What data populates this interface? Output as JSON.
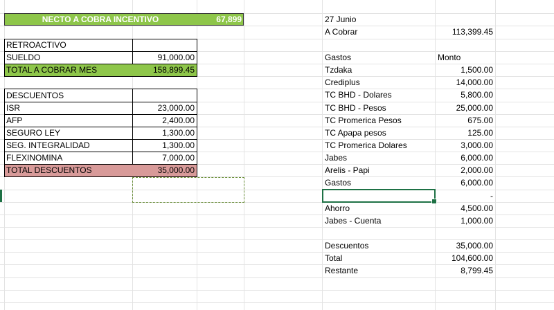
{
  "left": {
    "header": {
      "label": "NECTO  A COBRA INCENTIVO",
      "value": "67,899"
    },
    "retro": {
      "label": "RETROACTIVO",
      "value": ""
    },
    "sueldo": {
      "label": "SUELDO",
      "value": "91,000.00"
    },
    "total_mes": {
      "label": "TOTAL A COBRAR MES",
      "value": "158,899.45"
    },
    "descuentos_title": "DESCUENTOS",
    "descuentos": [
      {
        "label": "ISR",
        "value": "23,000.00"
      },
      {
        "label": "AFP",
        "value": "2,400.00"
      },
      {
        "label": "SEGURO LEY",
        "value": "1,300.00"
      },
      {
        "label": "SEG. INTEGRALIDAD",
        "value": "1,300.00"
      },
      {
        "label": "FLEXINOMINA",
        "value": "7,000.00"
      }
    ],
    "total_descuentos": {
      "label": "TOTAL DESCUENTOS",
      "value": "35,000.00"
    }
  },
  "right": {
    "date": "27 Junio",
    "a_cobrar": {
      "label": "A Cobrar",
      "value": "113,399.45"
    },
    "gastos_header": {
      "label": "Gastos",
      "value": "Monto"
    },
    "gastos": [
      {
        "label": "Tzdaka",
        "value": "1,500.00"
      },
      {
        "label": "Crediplus",
        "value": "14,000.00"
      },
      {
        "label": "TC BHD - Dolares",
        "value": "5,800.00"
      },
      {
        "label": "TC BHD - Pesos",
        "value": "25,000.00"
      },
      {
        "label": "TC Promerica Pesos",
        "value": "675.00"
      },
      {
        "label": "TC Apapa pesos",
        "value": "125.00"
      },
      {
        "label": "TC Promerica Dolares",
        "value": "3,000.00"
      },
      {
        "label": "Jabes",
        "value": "6,000.00"
      },
      {
        "label": "Arelis - Papi",
        "value": "2,000.00"
      },
      {
        "label": "Gastos",
        "value": "6,000.00"
      }
    ],
    "dash": "-",
    "ahorro": {
      "label": "Ahorro",
      "value": "4,500.00"
    },
    "jabes_cuenta": {
      "label": "Jabes - Cuenta",
      "value": "1,000.00"
    },
    "descuentos": {
      "label": "Descuentos",
      "value": "35,000.00"
    },
    "total": {
      "label": "Total",
      "value": "104,600.00"
    },
    "restante": {
      "label": "Restante",
      "value": "8,799.45"
    }
  },
  "colors": {
    "header_green": "#8ec64a",
    "total_green": "#8ec64a",
    "total_red": "#d89a99",
    "selection_green": "#1e7145"
  }
}
